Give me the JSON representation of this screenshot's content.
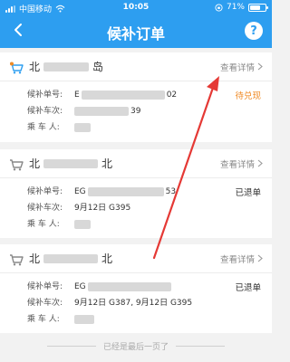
{
  "status_bar": {
    "carrier": "中国移动",
    "time": "10:05",
    "battery_text": "71%",
    "battery_level": 0.71
  },
  "header": {
    "title": "候补订单",
    "help_label": "?"
  },
  "orders": [
    {
      "route_start": "北",
      "route_end": "岛",
      "detail_label": "查看详情",
      "fields": [
        {
          "label": "候补单号:",
          "value_start": "E",
          "value_end": "02"
        },
        {
          "label": "候补车次:",
          "value_start": "",
          "value_end": "39"
        },
        {
          "label": "乘 车 人:",
          "value_start": "",
          "value_end": ""
        }
      ],
      "status": "待兑现"
    },
    {
      "route_start": "北",
      "route_end": "北",
      "detail_label": "查看详情",
      "fields": [
        {
          "label": "候补单号:",
          "value_start": "EG",
          "value_end": "53"
        },
        {
          "label": "候补车次:",
          "value_start": "9月12日 G395",
          "value_end": ""
        },
        {
          "label": "乘 车 人:",
          "value_start": "",
          "value_end": ""
        }
      ],
      "status": "已退单"
    },
    {
      "route_start": "北",
      "route_end": "北",
      "detail_label": "查看详情",
      "fields": [
        {
          "label": "候补单号:",
          "value_start": "EG",
          "value_end": ""
        },
        {
          "label": "候补车次:",
          "value_start": "9月12日 G387, 9月12日 G395",
          "value_end": ""
        },
        {
          "label": "乘 车 人:",
          "value_start": "",
          "value_end": ""
        }
      ],
      "status": "已退单"
    }
  ],
  "footer": {
    "end_text": "已经是最后一页了"
  },
  "colors": {
    "brand": "#2d9ef0",
    "pending": "#f08a24",
    "cart_highlight": "#2d9ef0",
    "cart_badge": "#f08a24",
    "arrow": "#e53935"
  }
}
